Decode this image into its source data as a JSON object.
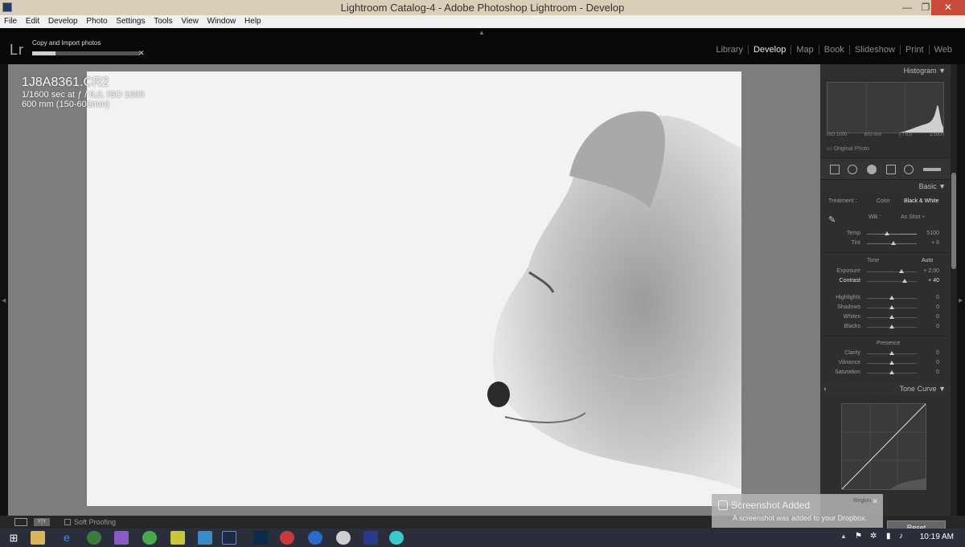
{
  "window": {
    "title": "Lightroom Catalog-4 - Adobe Photoshop Lightroom - Develop",
    "min": "—",
    "max": "❐",
    "close": "✕"
  },
  "menu": [
    "File",
    "Edit",
    "Develop",
    "Photo",
    "Settings",
    "Tools",
    "View",
    "Window",
    "Help"
  ],
  "top": {
    "logo": "Lr",
    "import_label": "Copy and Import photos",
    "import_progress": 0.22,
    "import_close": "✕"
  },
  "modules": [
    "Library",
    "Develop",
    "Map",
    "Book",
    "Slideshow",
    "Print",
    "Web"
  ],
  "active_module": "Develop",
  "photo_info": {
    "filename": "1J8A8361.CR2",
    "exposure": "1/1600 sec at ƒ / 8,0, ISO 1000",
    "lens": "600 mm (150-600mm)"
  },
  "histogram": {
    "title": "Histogram",
    "readout": [
      "ISO 1000",
      "600 mm",
      "ƒ / 8,0",
      "1/1600"
    ],
    "original_photo": "Original Photo"
  },
  "basic": {
    "title": "Basic",
    "treatment_label": "Treatment :",
    "treatment_color": "Color",
    "treatment_bw": "Black & White",
    "wb_label": "WB :",
    "wb_value": "As Shot ÷",
    "temp": {
      "label": "Temp",
      "value": "5100"
    },
    "tint": {
      "label": "Tint",
      "value": "+ 6"
    },
    "tone_label": "Tone",
    "auto_label": "Auto",
    "exposure": {
      "label": "Exposure",
      "value": "+ 2,00"
    },
    "contrast": {
      "label": "Contrast",
      "value": "+ 40"
    },
    "highlights": {
      "label": "Highlights",
      "value": "0"
    },
    "shadows": {
      "label": "Shadows",
      "value": "0"
    },
    "whites": {
      "label": "Whites",
      "value": "0"
    },
    "blacks": {
      "label": "Blacks",
      "value": "0"
    },
    "presence_label": "Presence",
    "clarity": {
      "label": "Clarity",
      "value": "0"
    },
    "vibrance": {
      "label": "Vibrance",
      "value": "0"
    },
    "saturation": {
      "label": "Saturation",
      "value": "0"
    }
  },
  "tone_curve": {
    "title": "Tone Curve"
  },
  "bottom": {
    "soft_proofing": "Soft Proofing",
    "reset": "Reset",
    "region": "Region"
  },
  "toast": {
    "title": "Screenshot Added",
    "message": "A screenshot was added to your Dropbox."
  },
  "taskbar": {
    "time": "10:19 AM"
  },
  "colors": {
    "accent": "#e8e8e8",
    "panel": "#2e2e2e",
    "taskbar": "#2a2e3b"
  }
}
